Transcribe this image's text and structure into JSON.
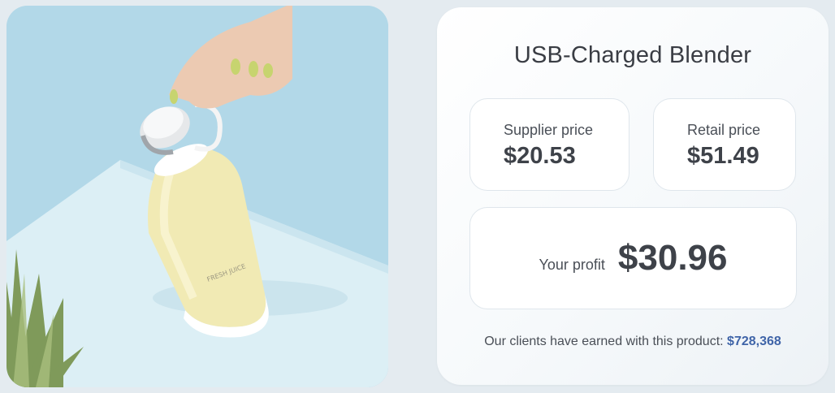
{
  "product": {
    "title": "USB-Charged Blender",
    "bottle_text": "FRESH JUICE"
  },
  "pricing": {
    "supplier_label": "Supplier price",
    "supplier_value": "$20.53",
    "retail_label": "Retail price",
    "retail_value": "$51.49",
    "profit_label": "Your profit",
    "profit_value": "$30.96"
  },
  "earnings": {
    "text": "Our clients have earned with this product:",
    "amount": "$728,368"
  },
  "colors": {
    "background": "#e4ebf0",
    "card": "#ffffff",
    "accent_amount": "#3f64a8",
    "text": "#3e4249"
  }
}
